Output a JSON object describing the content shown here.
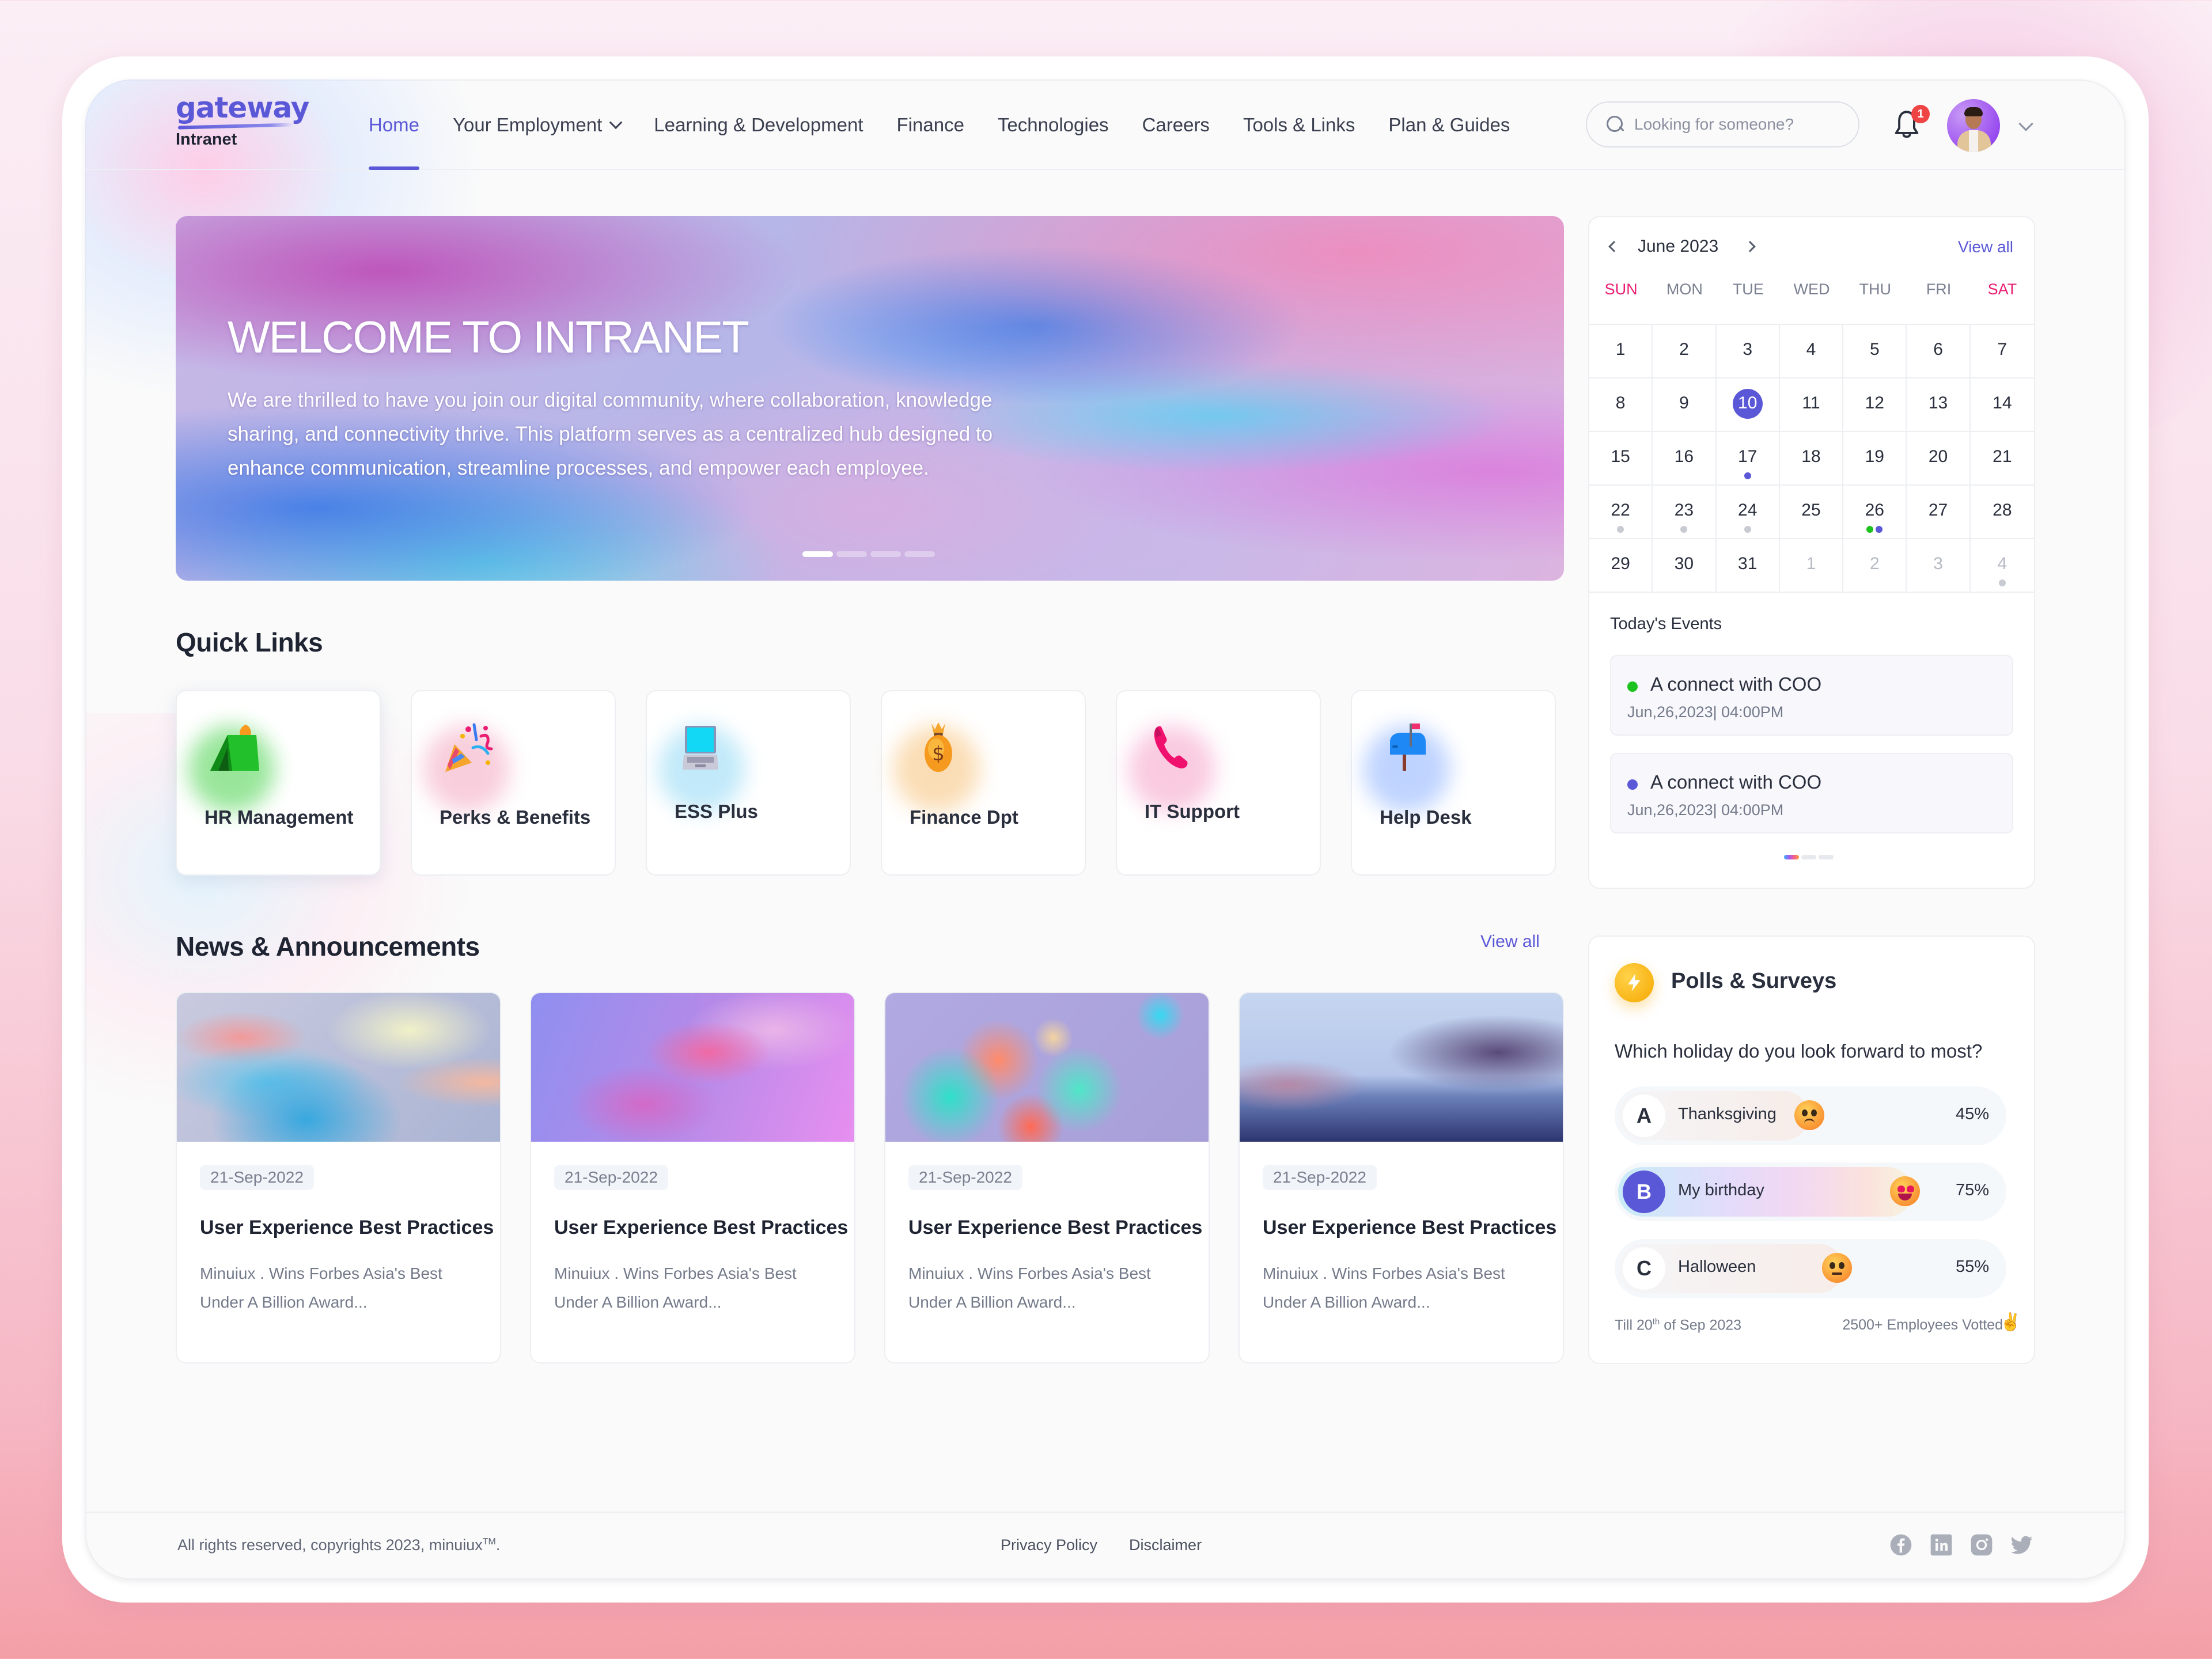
{
  "brand": {
    "name": "gateway",
    "subtitle": "Intranet",
    "accent": "#5b58d8"
  },
  "nav": {
    "items": [
      {
        "label": "Home",
        "active": true,
        "has_dropdown": false
      },
      {
        "label": "Your Employment",
        "active": false,
        "has_dropdown": true
      },
      {
        "label": "Learning & Development",
        "active": false,
        "has_dropdown": false
      },
      {
        "label": "Finance",
        "active": false,
        "has_dropdown": false
      },
      {
        "label": "Technologies",
        "active": false,
        "has_dropdown": false
      },
      {
        "label": "Careers",
        "active": false,
        "has_dropdown": false
      },
      {
        "label": "Tools & Links",
        "active": false,
        "has_dropdown": false
      },
      {
        "label": "Plan & Guides",
        "active": false,
        "has_dropdown": false
      }
    ]
  },
  "search": {
    "placeholder": "Looking for someone?",
    "value": ""
  },
  "notifications": {
    "icon": "bell-icon",
    "count": "1"
  },
  "profile": {
    "icon": "chevron-down-icon"
  },
  "hero": {
    "title": "WELCOME TO INTRANET",
    "text": "We are thrilled to have you join our digital community, where collaboration, knowledge sharing, and connectivity thrive. This platform serves as a centralized hub designed to enhance communication, streamline processes, and empower each employee.",
    "slides": 4,
    "active_slide": 1
  },
  "quick_links": {
    "title": "Quick Links",
    "items": [
      {
        "label": "HR  Management",
        "icon": "tent-icon"
      },
      {
        "label": "Perks & Benefits",
        "icon": "party-popper-icon"
      },
      {
        "label": "ESS Plus",
        "icon": "laptop-icon"
      },
      {
        "label": "Finance Dpt",
        "icon": "money-bag-icon"
      },
      {
        "label": "IT Support",
        "icon": "phone-icon"
      },
      {
        "label": "Help Desk",
        "icon": "mailbox-icon"
      }
    ]
  },
  "news": {
    "title": "News & Announcements",
    "view_all": "View all",
    "items": [
      {
        "date": "21-Sep-2022",
        "title": "User Experience Best Practices",
        "desc": "Minuiux . Wins Forbes Asia's Best Under A Billion Award..."
      },
      {
        "date": "21-Sep-2022",
        "title": "User Experience Best Practices",
        "desc": "Minuiux . Wins Forbes Asia's Best Under A Billion Award..."
      },
      {
        "date": "21-Sep-2022",
        "title": "User Experience Best Practices",
        "desc": "Minuiux . Wins Forbes Asia's Best Under A Billion Award..."
      },
      {
        "date": "21-Sep-2022",
        "title": "User Experience Best Practices",
        "desc": "Minuiux . Wins Forbes Asia's Best Under A Billion Award..."
      }
    ]
  },
  "calendar": {
    "month_label": "June 2023",
    "view_all": "View all",
    "weekdays": [
      "SUN",
      "MON",
      "TUE",
      "WED",
      "THU",
      "FRI",
      "SAT"
    ],
    "weekend_color": "#e91e72",
    "days": [
      {
        "n": "1"
      },
      {
        "n": "2"
      },
      {
        "n": "3"
      },
      {
        "n": "4"
      },
      {
        "n": "5"
      },
      {
        "n": "6"
      },
      {
        "n": "7"
      },
      {
        "n": "8"
      },
      {
        "n": "9"
      },
      {
        "n": "10",
        "today": true
      },
      {
        "n": "11"
      },
      {
        "n": "12"
      },
      {
        "n": "13"
      },
      {
        "n": "14"
      },
      {
        "n": "15"
      },
      {
        "n": "16"
      },
      {
        "n": "17",
        "dots": [
          "#5b58d8"
        ]
      },
      {
        "n": "18"
      },
      {
        "n": "19"
      },
      {
        "n": "20"
      },
      {
        "n": "21"
      },
      {
        "n": "22",
        "dots": [
          "#c8cbd2"
        ]
      },
      {
        "n": "23",
        "dots": [
          "#c8cbd2"
        ]
      },
      {
        "n": "24",
        "dots": [
          "#c8cbd2"
        ]
      },
      {
        "n": "25"
      },
      {
        "n": "26",
        "dots": [
          "#1ec21e",
          "#5b58d8"
        ]
      },
      {
        "n": "27"
      },
      {
        "n": "28"
      },
      {
        "n": "29"
      },
      {
        "n": "30"
      },
      {
        "n": "31"
      },
      {
        "n": "1",
        "muted": true
      },
      {
        "n": "2",
        "muted": true
      },
      {
        "n": "3",
        "muted": true
      },
      {
        "n": "4",
        "muted": true,
        "dots": [
          "#c8cbd2"
        ]
      }
    ],
    "events_title": "Today's Events",
    "events": [
      {
        "title": "A connect with COO",
        "time": "Jun,26,2023| 04:00PM",
        "color": "#1ec21e"
      },
      {
        "title": "A connect with COO",
        "time": "Jun,26,2023| 04:00PM",
        "color": "#5b58d8"
      }
    ],
    "pages": 3,
    "active_page": 1
  },
  "polls": {
    "title": "Polls & Surveys",
    "icon": "lightning-icon",
    "question": "Which holiday do you look forward to most?",
    "options": [
      {
        "letter": "A",
        "label": "Thanksgiving",
        "percent": 45,
        "percent_label": "45%",
        "emoji": "worried-face-icon",
        "selected": false
      },
      {
        "letter": "B",
        "label": "My birthday",
        "percent": 75,
        "percent_label": "75%",
        "emoji": "heart-eyes-face-icon",
        "selected": true
      },
      {
        "letter": "C",
        "label": "Halloween",
        "percent": 55,
        "percent_label": "55%",
        "emoji": "neutral-face-icon",
        "selected": false
      }
    ],
    "deadline_prefix": "Till 20",
    "deadline_sup": "th",
    "deadline_suffix": " of Sep 2023",
    "votes": "2500+ Employees Votted"
  },
  "footer": {
    "copyright": "All rights reserved, copyrights 2023, minuiux",
    "tm": "TM",
    "copyright_end": ".",
    "links": [
      "Privacy Policy",
      "Disclaimer"
    ],
    "socials": [
      "facebook-icon",
      "linkedin-icon",
      "instagram-icon",
      "twitter-icon"
    ]
  }
}
